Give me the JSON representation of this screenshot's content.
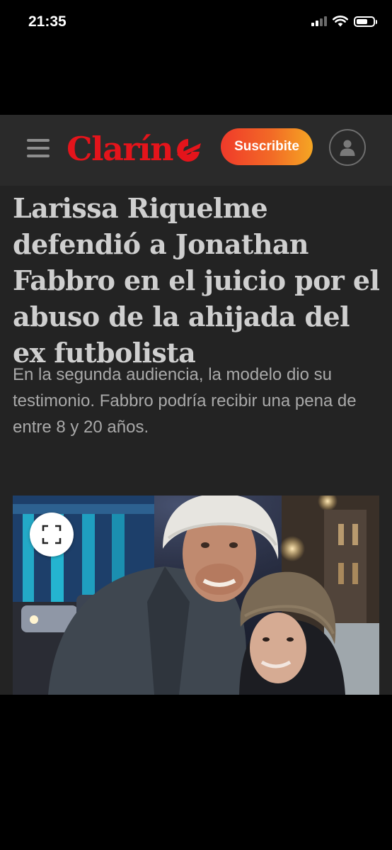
{
  "status_bar": {
    "time": "21:35",
    "icons": [
      "cellular-signal-icon",
      "wifi-icon",
      "battery-icon"
    ]
  },
  "header": {
    "logo_text": "Clarín",
    "subscribe_label": "Suscribite",
    "icons": [
      "menu-icon",
      "user-icon"
    ],
    "colors": {
      "logo_red": "#e4141b",
      "subscribe_gradient_start": "#f03a2a",
      "subscribe_gradient_end": "#f5a623",
      "header_bg": "#2a2a2a"
    }
  },
  "article": {
    "headline": "Larissa Riquelme defendió a Jonathan Fabbro en el juicio por el abuso de la ahijada del ex futbolista",
    "subtitle": "En la segunda audiencia, la modelo dio su testimonio. Fabbro podría recibir una pena de entre 8 y 20 años.",
    "image_icon": "expand-icon"
  }
}
